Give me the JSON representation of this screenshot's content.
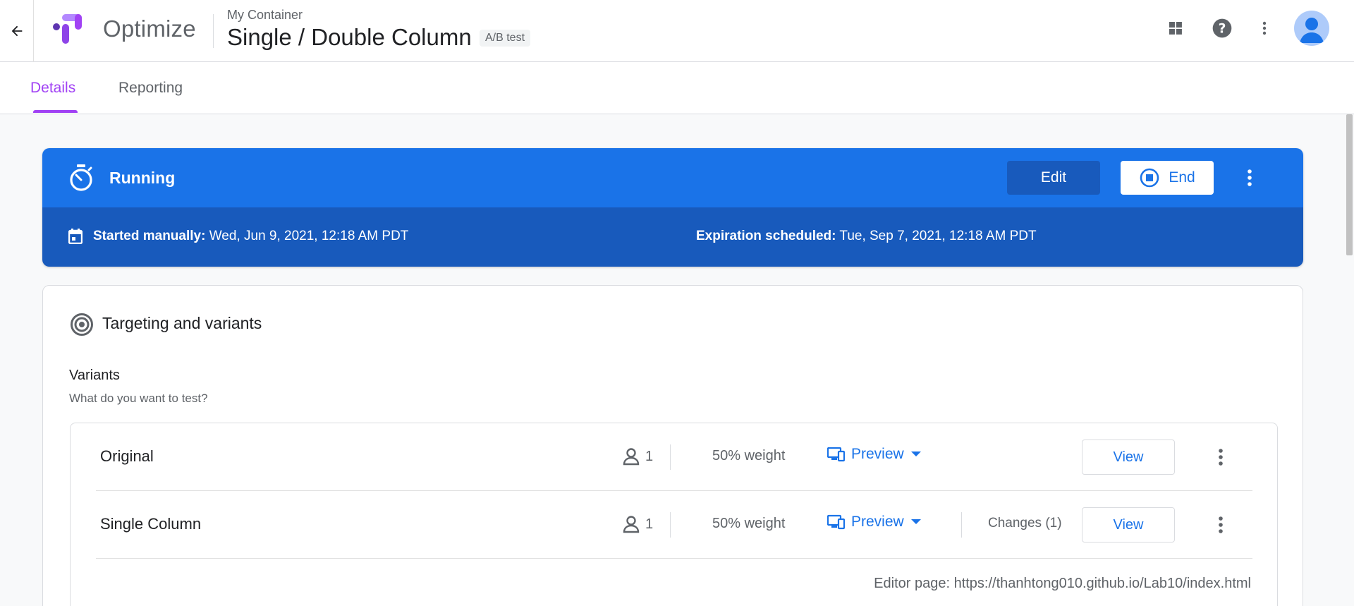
{
  "header": {
    "product_name": "Optimize",
    "container_name": "My Container",
    "experience_title": "Single / Double Column",
    "experience_type": "A/B test",
    "icons": [
      "back-arrow-icon",
      "apps-grid-icon",
      "help-icon",
      "more-vert-icon",
      "account-avatar-icon"
    ]
  },
  "tabs": [
    {
      "label": "Details",
      "active": true
    },
    {
      "label": "Reporting",
      "active": false
    }
  ],
  "status": {
    "label": "Running",
    "edit_label": "Edit",
    "end_label": "End",
    "started_label": "Started manually:",
    "started_value": " Wed, Jun 9, 2021, 12:18 AM PDT",
    "expiration_label": "Expiration scheduled:",
    "expiration_value": " Tue, Sep 7, 2021, 12:18 AM PDT"
  },
  "targeting": {
    "title": "Targeting and variants",
    "variants_heading": "Variants",
    "variants_subheading": "What do you want to test?",
    "variants": [
      {
        "name": "Original",
        "people": "1",
        "weight": "50% weight",
        "preview_label": "Preview",
        "changes": "",
        "view_label": "View"
      },
      {
        "name": "Single Column",
        "people": "1",
        "weight": "50% weight",
        "preview_label": "Preview",
        "changes": "Changes (1)",
        "view_label": "View"
      }
    ],
    "editor_page": "Editor page: https://thanhtong010.github.io/Lab10/index.html"
  },
  "colors": {
    "accent_purple": "#a142f4",
    "primary_blue": "#1a73e8",
    "dark_blue": "#185abc"
  }
}
